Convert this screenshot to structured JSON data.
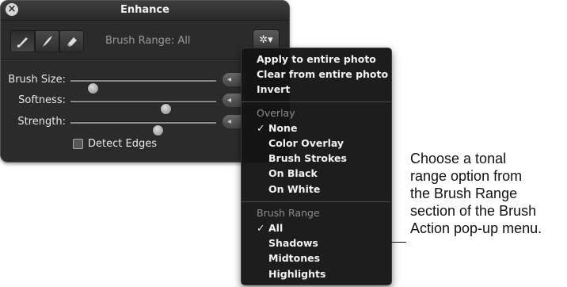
{
  "window": {
    "title": "Enhance"
  },
  "toolbar": {
    "tools": [
      "brush-icon",
      "feather-brush-icon",
      "eraser-icon"
    ],
    "brush_range_label": "Brush Range: All",
    "action_icon": "gear-icon"
  },
  "sliders": [
    {
      "label": "Brush Size:",
      "value": 0.15
    },
    {
      "label": "Softness:",
      "value": 0.65
    },
    {
      "label": "Strength:",
      "value": 0.6
    }
  ],
  "detect_edges": {
    "label": "Detect Edges",
    "checked": false
  },
  "menu": {
    "items_top": [
      "Apply to entire photo",
      "Clear from entire photo",
      "Invert"
    ],
    "overlay_header": "Overlay",
    "overlay_items": [
      "None",
      "Color Overlay",
      "Brush Strokes",
      "On Black",
      "On White"
    ],
    "overlay_selected": "None",
    "range_header": "Brush Range",
    "range_items": [
      "All",
      "Shadows",
      "Midtones",
      "Highlights"
    ],
    "range_selected": "All",
    "checkmark": "✓"
  },
  "caption": {
    "lines": [
      "Choose a tonal",
      "range option from",
      "the Brush Range",
      "section of the Brush",
      "Action pop-up menu."
    ]
  }
}
